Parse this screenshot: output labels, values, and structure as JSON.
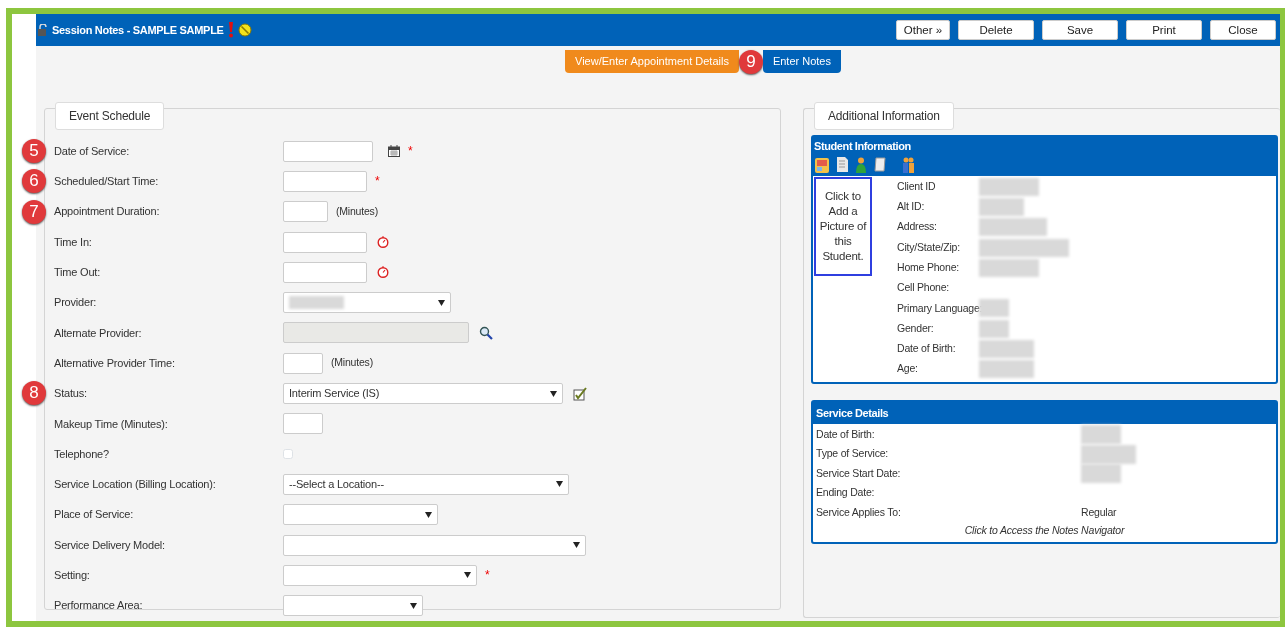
{
  "window": {
    "title": "Session Notes - SAMPLE SAMPLE"
  },
  "header_buttons": [
    "Other »",
    "Delete",
    "Save",
    "Print",
    "Close"
  ],
  "tabs": [
    {
      "label": "View/Enter Appointment Details",
      "selected": true
    },
    {
      "label": "Enter Notes",
      "selected": false
    }
  ],
  "tab_callout": "9",
  "event_schedule": {
    "title": "Event Schedule",
    "fields": [
      {
        "label": "Date of Service:",
        "kind": "input",
        "callout": "5",
        "required_mark": "*"
      },
      {
        "label": "Scheduled/Start Time:",
        "kind": "input",
        "callout": "6",
        "required_mark": "*"
      },
      {
        "label": "Appointment Duration:",
        "kind": "input",
        "callout": "7",
        "suffix": "(Minutes)"
      },
      {
        "label": "Time In:",
        "kind": "input"
      },
      {
        "label": "Time Out:",
        "kind": "input"
      },
      {
        "label": "Provider:",
        "kind": "select",
        "value_hidden": true
      },
      {
        "label": "Alternate Provider:",
        "kind": "input",
        "disabled": true
      },
      {
        "label": "Alternative Provider Time:",
        "kind": "input",
        "suffix": "(Minutes)"
      },
      {
        "label": "Status:",
        "kind": "select",
        "callout": "8",
        "value": "Interim Service (IS)"
      },
      {
        "label": "Makeup Time (Minutes):",
        "kind": "input"
      },
      {
        "label": "Telephone?",
        "kind": "checkbox",
        "checked": false
      },
      {
        "label": "Service Location (Billing Location):",
        "kind": "select",
        "value": "--Select a Location--"
      },
      {
        "label": "Place of Service:",
        "kind": "select"
      },
      {
        "label": "Service Delivery Model:",
        "kind": "select"
      },
      {
        "label": "Setting:",
        "kind": "select",
        "required_mark": "*"
      },
      {
        "label": "Performance Area:",
        "kind": "select"
      }
    ]
  },
  "additional_information": {
    "title": "Additional Information",
    "student_information": {
      "title": "Student Information",
      "picture_prompt": "Click to Add a Picture of this Student.",
      "rows": [
        {
          "label": "Client ID",
          "value_hidden": true
        },
        {
          "label": "Alt ID:",
          "value_hidden": true
        },
        {
          "label": "Address:",
          "value_hidden": true
        },
        {
          "label": "City/State/Zip:",
          "value_hidden": true
        },
        {
          "label": "Home Phone:",
          "value_hidden": true
        },
        {
          "label": "Cell Phone:",
          "value_hidden": false
        },
        {
          "label": "Primary Language:",
          "value_hidden": true
        },
        {
          "label": "Gender:",
          "value_hidden": true
        },
        {
          "label": "Date of Birth:",
          "value_hidden": true
        },
        {
          "label": "Age:",
          "value_hidden": true
        }
      ]
    },
    "service_details": {
      "title": "Service Details",
      "rows": [
        {
          "label": "Date of Birth:",
          "value_hidden": true
        },
        {
          "label": "Type of Service:",
          "value_hidden": true
        },
        {
          "label": "Service Start Date:",
          "value_hidden": true
        },
        {
          "label": "Ending Date:"
        },
        {
          "label": "Service Applies To:",
          "value": "Regular"
        }
      ],
      "link": "Click to Access the Notes Navigator"
    }
  }
}
